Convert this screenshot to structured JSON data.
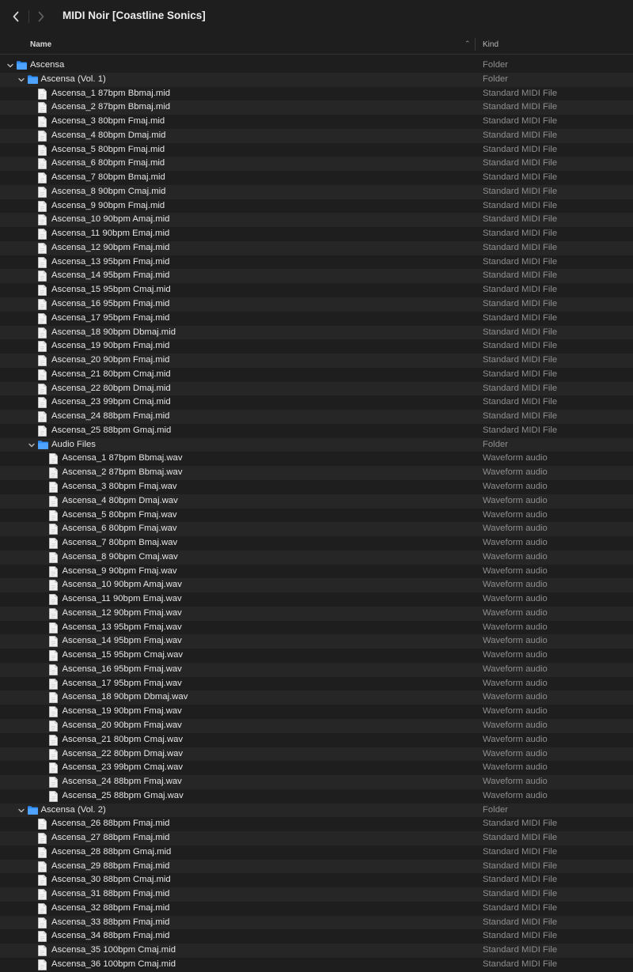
{
  "window": {
    "title": "MIDI Noir [Coastline Sonics]"
  },
  "header": {
    "name_label": "Name",
    "kind_label": "Kind"
  },
  "rows": [
    {
      "name": "Ascensa",
      "kind": "Folder",
      "type": "folder",
      "depth": 0
    },
    {
      "name": "Ascensa (Vol. 1)",
      "kind": "Folder",
      "type": "folder",
      "depth": 1
    },
    {
      "name": "Ascensa_1 87bpm Bbmaj.mid",
      "kind": "Standard MIDI File",
      "type": "file",
      "depth": 2
    },
    {
      "name": "Ascensa_2 87bpm Bbmaj.mid",
      "kind": "Standard MIDI File",
      "type": "file",
      "depth": 2
    },
    {
      "name": "Ascensa_3 80bpm Fmaj.mid",
      "kind": "Standard MIDI File",
      "type": "file",
      "depth": 2
    },
    {
      "name": "Ascensa_4 80bpm Dmaj.mid",
      "kind": "Standard MIDI File",
      "type": "file",
      "depth": 2
    },
    {
      "name": "Ascensa_5 80bpm Fmaj.mid",
      "kind": "Standard MIDI File",
      "type": "file",
      "depth": 2
    },
    {
      "name": "Ascensa_6 80bpm Fmaj.mid",
      "kind": "Standard MIDI File",
      "type": "file",
      "depth": 2
    },
    {
      "name": "Ascensa_7 80bpm Bmaj.mid",
      "kind": "Standard MIDI File",
      "type": "file",
      "depth": 2
    },
    {
      "name": "Ascensa_8 90bpm Cmaj.mid",
      "kind": "Standard MIDI File",
      "type": "file",
      "depth": 2
    },
    {
      "name": "Ascensa_9 90bpm Fmaj.mid",
      "kind": "Standard MIDI File",
      "type": "file",
      "depth": 2
    },
    {
      "name": "Ascensa_10 90bpm Amaj.mid",
      "kind": "Standard MIDI File",
      "type": "file",
      "depth": 2
    },
    {
      "name": "Ascensa_11 90bpm Emaj.mid",
      "kind": "Standard MIDI File",
      "type": "file",
      "depth": 2
    },
    {
      "name": "Ascensa_12 90bpm Fmaj.mid",
      "kind": "Standard MIDI File",
      "type": "file",
      "depth": 2
    },
    {
      "name": "Ascensa_13 95bpm Fmaj.mid",
      "kind": "Standard MIDI File",
      "type": "file",
      "depth": 2
    },
    {
      "name": "Ascensa_14 95bpm Fmaj.mid",
      "kind": "Standard MIDI File",
      "type": "file",
      "depth": 2
    },
    {
      "name": "Ascensa_15 95bpm Cmaj.mid",
      "kind": "Standard MIDI File",
      "type": "file",
      "depth": 2
    },
    {
      "name": "Ascensa_16 95bpm Fmaj.mid",
      "kind": "Standard MIDI File",
      "type": "file",
      "depth": 2
    },
    {
      "name": "Ascensa_17 95bpm Fmaj.mid",
      "kind": "Standard MIDI File",
      "type": "file",
      "depth": 2
    },
    {
      "name": "Ascensa_18 90bpm Dbmaj.mid",
      "kind": "Standard MIDI File",
      "type": "file",
      "depth": 2
    },
    {
      "name": "Ascensa_19 90bpm Fmaj.mid",
      "kind": "Standard MIDI File",
      "type": "file",
      "depth": 2
    },
    {
      "name": "Ascensa_20 90bpm Fmaj.mid",
      "kind": "Standard MIDI File",
      "type": "file",
      "depth": 2
    },
    {
      "name": "Ascensa_21 80bpm Cmaj.mid",
      "kind": "Standard MIDI File",
      "type": "file",
      "depth": 2
    },
    {
      "name": "Ascensa_22 80bpm Dmaj.mid",
      "kind": "Standard MIDI File",
      "type": "file",
      "depth": 2
    },
    {
      "name": "Ascensa_23 99bpm Cmaj.mid",
      "kind": "Standard MIDI File",
      "type": "file",
      "depth": 2
    },
    {
      "name": "Ascensa_24 88bpm Fmaj.mid",
      "kind": "Standard MIDI File",
      "type": "file",
      "depth": 2
    },
    {
      "name": "Ascensa_25 88bpm Gmaj.mid",
      "kind": "Standard MIDI File",
      "type": "file",
      "depth": 2
    },
    {
      "name": "Audio Files",
      "kind": "Folder",
      "type": "folder",
      "depth": 2
    },
    {
      "name": "Ascensa_1 87bpm Bbmaj.wav",
      "kind": "Waveform audio",
      "type": "file",
      "depth": 3
    },
    {
      "name": "Ascensa_2 87bpm Bbmaj.wav",
      "kind": "Waveform audio",
      "type": "file",
      "depth": 3
    },
    {
      "name": "Ascensa_3 80bpm Fmaj.wav",
      "kind": "Waveform audio",
      "type": "file",
      "depth": 3
    },
    {
      "name": "Ascensa_4 80bpm Dmaj.wav",
      "kind": "Waveform audio",
      "type": "file",
      "depth": 3
    },
    {
      "name": "Ascensa_5 80bpm Fmaj.wav",
      "kind": "Waveform audio",
      "type": "file",
      "depth": 3
    },
    {
      "name": "Ascensa_6 80bpm Fmaj.wav",
      "kind": "Waveform audio",
      "type": "file",
      "depth": 3
    },
    {
      "name": "Ascensa_7 80bpm Bmaj.wav",
      "kind": "Waveform audio",
      "type": "file",
      "depth": 3
    },
    {
      "name": "Ascensa_8 90bpm Cmaj.wav",
      "kind": "Waveform audio",
      "type": "file",
      "depth": 3
    },
    {
      "name": "Ascensa_9 90bpm Fmaj.wav",
      "kind": "Waveform audio",
      "type": "file",
      "depth": 3
    },
    {
      "name": "Ascensa_10 90bpm Amaj.wav",
      "kind": "Waveform audio",
      "type": "file",
      "depth": 3
    },
    {
      "name": "Ascensa_11 90bpm Emaj.wav",
      "kind": "Waveform audio",
      "type": "file",
      "depth": 3
    },
    {
      "name": "Ascensa_12 90bpm Fmaj.wav",
      "kind": "Waveform audio",
      "type": "file",
      "depth": 3
    },
    {
      "name": "Ascensa_13 95bpm Fmaj.wav",
      "kind": "Waveform audio",
      "type": "file",
      "depth": 3
    },
    {
      "name": "Ascensa_14 95bpm Fmaj.wav",
      "kind": "Waveform audio",
      "type": "file",
      "depth": 3
    },
    {
      "name": "Ascensa_15 95bpm Cmaj.wav",
      "kind": "Waveform audio",
      "type": "file",
      "depth": 3
    },
    {
      "name": "Ascensa_16 95bpm Fmaj.wav",
      "kind": "Waveform audio",
      "type": "file",
      "depth": 3
    },
    {
      "name": "Ascensa_17 95bpm Fmaj.wav",
      "kind": "Waveform audio",
      "type": "file",
      "depth": 3
    },
    {
      "name": "Ascensa_18 90bpm Dbmaj.wav",
      "kind": "Waveform audio",
      "type": "file",
      "depth": 3
    },
    {
      "name": "Ascensa_19 90bpm Fmaj.wav",
      "kind": "Waveform audio",
      "type": "file",
      "depth": 3
    },
    {
      "name": "Ascensa_20 90bpm Fmaj.wav",
      "kind": "Waveform audio",
      "type": "file",
      "depth": 3
    },
    {
      "name": "Ascensa_21 80bpm Cmaj.wav",
      "kind": "Waveform audio",
      "type": "file",
      "depth": 3
    },
    {
      "name": "Ascensa_22 80bpm Dmaj.wav",
      "kind": "Waveform audio",
      "type": "file",
      "depth": 3
    },
    {
      "name": "Ascensa_23 99bpm Cmaj.wav",
      "kind": "Waveform audio",
      "type": "file",
      "depth": 3
    },
    {
      "name": "Ascensa_24 88bpm Fmaj.wav",
      "kind": "Waveform audio",
      "type": "file",
      "depth": 3
    },
    {
      "name": "Ascensa_25 88bpm Gmaj.wav",
      "kind": "Waveform audio",
      "type": "file",
      "depth": 3
    },
    {
      "name": "Ascensa (Vol. 2)",
      "kind": "Folder",
      "type": "folder",
      "depth": 1
    },
    {
      "name": "Ascensa_26 88bpm Fmaj.mid",
      "kind": "Standard MIDI File",
      "type": "file",
      "depth": 2
    },
    {
      "name": "Ascensa_27 88bpm Fmaj.mid",
      "kind": "Standard MIDI File",
      "type": "file",
      "depth": 2
    },
    {
      "name": "Ascensa_28 88bpm Gmaj.mid",
      "kind": "Standard MIDI File",
      "type": "file",
      "depth": 2
    },
    {
      "name": "Ascensa_29 88bpm Fmaj.mid",
      "kind": "Standard MIDI File",
      "type": "file",
      "depth": 2
    },
    {
      "name": "Ascensa_30 88bpm Cmaj.mid",
      "kind": "Standard MIDI File",
      "type": "file",
      "depth": 2
    },
    {
      "name": "Ascensa_31 88bpm Fmaj.mid",
      "kind": "Standard MIDI File",
      "type": "file",
      "depth": 2
    },
    {
      "name": "Ascensa_32 88bpm Fmaj.mid",
      "kind": "Standard MIDI File",
      "type": "file",
      "depth": 2
    },
    {
      "name": "Ascensa_33 88bpm Fmaj.mid",
      "kind": "Standard MIDI File",
      "type": "file",
      "depth": 2
    },
    {
      "name": "Ascensa_34 88bpm Fmaj.mid",
      "kind": "Standard MIDI File",
      "type": "file",
      "depth": 2
    },
    {
      "name": "Ascensa_35 100bpm Cmaj.mid",
      "kind": "Standard MIDI File",
      "type": "file",
      "depth": 2
    },
    {
      "name": "Ascensa_36 100bpm Cmaj.mid",
      "kind": "Standard MIDI File",
      "type": "file",
      "depth": 2
    }
  ],
  "colors": {
    "folder": "#2f8cf4",
    "background": "#1e1e1e",
    "row_alt": "#262626",
    "kind_text": "#8e8e8e"
  },
  "icons": {
    "back": "chevron-left-icon",
    "forward": "chevron-right-icon",
    "folder": "folder-icon",
    "file": "document-icon",
    "disclosure": "chevron-down-icon"
  }
}
